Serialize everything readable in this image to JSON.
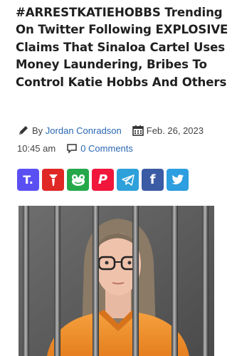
{
  "article": {
    "title": "#ARRESTKATIEHOBBS Trending On Twitter Following EXPLOSIVE Claims That Sinaloa Cartel Uses Money Laundering, Bribes To Control Katie Hobbs And Others",
    "by_label": "By",
    "author": "Jordan Conradson",
    "date": "Feb. 26, 2023",
    "time": "10:45 am",
    "comments": "0 Comments"
  },
  "share": [
    {
      "name": "truth-social",
      "glyph": "T.",
      "color": "#5a4ff3"
    },
    {
      "name": "gettr",
      "glyph": "",
      "color": "#e02826"
    },
    {
      "name": "parler-frog",
      "glyph": "",
      "color": "#25a84a"
    },
    {
      "name": "parler",
      "glyph": "P",
      "color": "#f0163c"
    },
    {
      "name": "telegram",
      "glyph": "",
      "color": "#2ea0da"
    },
    {
      "name": "facebook",
      "glyph": "f",
      "color": "#3b5ba4"
    },
    {
      "name": "twitter",
      "glyph": "",
      "color": "#2d9ee0"
    }
  ],
  "icons": {
    "author": "pencil-icon",
    "date": "calendar-icon",
    "comments": "comment-icon"
  }
}
